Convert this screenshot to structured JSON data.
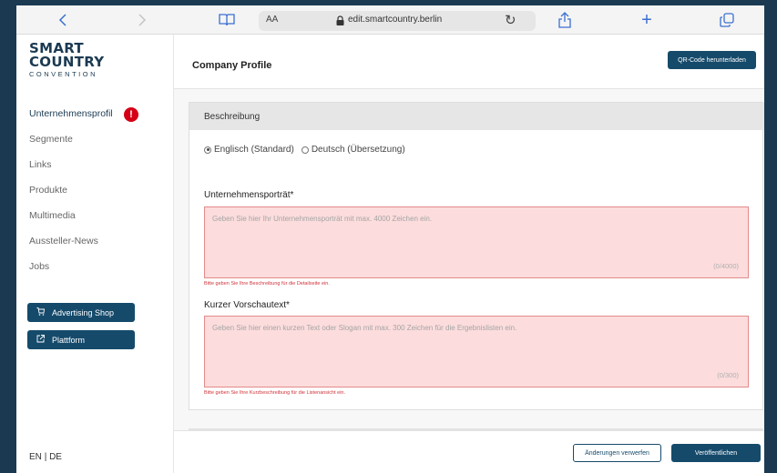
{
  "browser": {
    "address_size_label": "AA",
    "url": "edit.smartcountry.berlin",
    "icons": [
      "chevron-left-icon",
      "chevron-right-icon",
      "book-icon",
      "lock-icon",
      "reload-icon",
      "share-icon",
      "plus-icon",
      "tabs-icon"
    ]
  },
  "logo": {
    "line1": "SMART",
    "line2": "COUNTRY",
    "line3": "CONVENTION"
  },
  "sidebar": {
    "items": [
      {
        "label": "Unternehmensprofil",
        "active": true,
        "alert": "!"
      },
      {
        "label": "Segmente"
      },
      {
        "label": "Links"
      },
      {
        "label": "Produkte"
      },
      {
        "label": "Multimedia"
      },
      {
        "label": "Aussteller-News"
      },
      {
        "label": "Jobs"
      }
    ],
    "advertising_button": "Advertising Shop",
    "platform_button": "Plattform",
    "lang_en": "EN",
    "lang_sep": "|",
    "lang_de": "DE"
  },
  "header": {
    "title": "Company Profile",
    "qr_button": "QR-Code herunterladen"
  },
  "card": {
    "title": "Beschreibung",
    "radio_english": "Englisch (Standard)",
    "radio_german": "Deutsch (Übersetzung)",
    "portrait_label": "Unternehmensporträt*",
    "portrait_placeholder": "Geben Sie hier Ihr Unternehmensporträt mit max. 4000 Zeichen ein.",
    "portrait_counter": "(0/4000)",
    "portrait_error": "Bitte geben Sie Ihre Beschreibung für die Detailseite ein.",
    "short_label": "Kurzer Vorschautext*",
    "short_placeholder": "Geben Sie hier einen kurzen Text oder Slogan mit max. 300 Zeichen für die Ergebnislisten ein.",
    "short_counter": "(0/300)",
    "short_error": "Bitte geben Sie Ihre Kurzbeschreibung für die Listenansicht ein."
  },
  "footer": {
    "discard_button": "Änderungen verwerfen",
    "publish_button": "Veröffentlichen"
  },
  "colors": {
    "brand": "#154a6b",
    "error": "#d0333a",
    "error_fill": "#fcdcdc",
    "alert": "#d40016"
  }
}
